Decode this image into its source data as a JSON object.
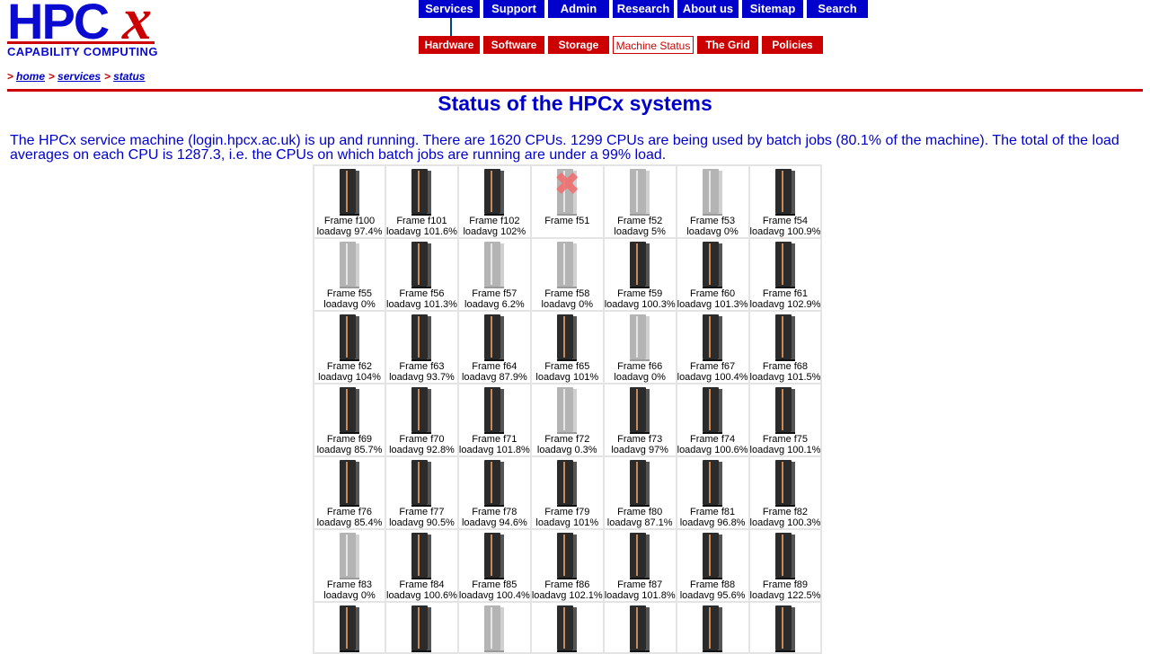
{
  "logo": {
    "main": "HPC",
    "x": "x",
    "subtitle": "CAPABILITY COMPUTING"
  },
  "nav_primary": [
    "Services",
    "Support",
    "Admin",
    "Research",
    "About us",
    "Sitemap",
    "Search"
  ],
  "nav_secondary": [
    "Hardware",
    "Software",
    "Storage",
    "Machine Status",
    "The Grid",
    "Policies"
  ],
  "breadcrumb": {
    "separator": ">",
    "items": [
      "home",
      "services",
      "status"
    ]
  },
  "title": "Status of the HPCx systems",
  "summary": "The HPCx service machine (login.hpcx.ac.uk) is up and running. There are 1620 CPUs. 1299 CPUs are being used by batch jobs (80.1% of the machine). The total of the load averages on each CPU is 1287.3, i.e. the CPUs on which batch jobs are running are under a 99% load.",
  "colors": {
    "nav_primary": "#0000cc",
    "nav_secondary": "#cc0000",
    "text": "#0000cc",
    "rule": "#cc0000"
  },
  "frames": [
    {
      "name": "Frame f100",
      "load": "loadavg 97.4%",
      "state": "busy"
    },
    {
      "name": "Frame f101",
      "load": "loadavg 101.6%",
      "state": "busy"
    },
    {
      "name": "Frame f102",
      "load": "loadavg 102%",
      "state": "busy"
    },
    {
      "name": "Frame f51",
      "load": "",
      "state": "down"
    },
    {
      "name": "Frame f52",
      "load": "loadavg 5%",
      "state": "idle"
    },
    {
      "name": "Frame f53",
      "load": "loadavg 0%",
      "state": "idle"
    },
    {
      "name": "Frame f54",
      "load": "loadavg 100.9%",
      "state": "busy"
    },
    {
      "name": "Frame f55",
      "load": "loadavg 0%",
      "state": "idle"
    },
    {
      "name": "Frame f56",
      "load": "loadavg 101.3%",
      "state": "busy"
    },
    {
      "name": "Frame f57",
      "load": "loadavg 6.2%",
      "state": "idle"
    },
    {
      "name": "Frame f58",
      "load": "loadavg 0%",
      "state": "idle"
    },
    {
      "name": "Frame f59",
      "load": "loadavg 100.3%",
      "state": "busy"
    },
    {
      "name": "Frame f60",
      "load": "loadavg 101.3%",
      "state": "busy"
    },
    {
      "name": "Frame f61",
      "load": "loadavg 102.9%",
      "state": "busy"
    },
    {
      "name": "Frame f62",
      "load": "loadavg 104%",
      "state": "busy"
    },
    {
      "name": "Frame f63",
      "load": "loadavg 93.7%",
      "state": "busy"
    },
    {
      "name": "Frame f64",
      "load": "loadavg 87.9%",
      "state": "busy"
    },
    {
      "name": "Frame f65",
      "load": "loadavg 101%",
      "state": "busy"
    },
    {
      "name": "Frame f66",
      "load": "loadavg 0%",
      "state": "idle"
    },
    {
      "name": "Frame f67",
      "load": "loadavg 100.4%",
      "state": "busy"
    },
    {
      "name": "Frame f68",
      "load": "loadavg 101.5%",
      "state": "busy"
    },
    {
      "name": "Frame f69",
      "load": "loadavg 85.7%",
      "state": "busy"
    },
    {
      "name": "Frame f70",
      "load": "loadavg 92.8%",
      "state": "busy"
    },
    {
      "name": "Frame f71",
      "load": "loadavg 101.8%",
      "state": "busy"
    },
    {
      "name": "Frame f72",
      "load": "loadavg 0.3%",
      "state": "idle"
    },
    {
      "name": "Frame f73",
      "load": "loadavg 97%",
      "state": "busy"
    },
    {
      "name": "Frame f74",
      "load": "loadavg 100.6%",
      "state": "busy"
    },
    {
      "name": "Frame f75",
      "load": "loadavg 100.1%",
      "state": "busy"
    },
    {
      "name": "Frame f76",
      "load": "loadavg 85.4%",
      "state": "busy"
    },
    {
      "name": "Frame f77",
      "load": "loadavg 90.5%",
      "state": "busy"
    },
    {
      "name": "Frame f78",
      "load": "loadavg 94.6%",
      "state": "busy"
    },
    {
      "name": "Frame f79",
      "load": "loadavg 101%",
      "state": "busy"
    },
    {
      "name": "Frame f80",
      "load": "loadavg 87.1%",
      "state": "busy"
    },
    {
      "name": "Frame f81",
      "load": "loadavg 96.8%",
      "state": "busy"
    },
    {
      "name": "Frame f82",
      "load": "loadavg 100.3%",
      "state": "busy"
    },
    {
      "name": "Frame f83",
      "load": "loadavg 0%",
      "state": "idle"
    },
    {
      "name": "Frame f84",
      "load": "loadavg 100.6%",
      "state": "busy"
    },
    {
      "name": "Frame f85",
      "load": "loadavg 100.4%",
      "state": "busy"
    },
    {
      "name": "Frame f86",
      "load": "loadavg 102.1%",
      "state": "busy"
    },
    {
      "name": "Frame f87",
      "load": "loadavg 101.8%",
      "state": "busy"
    },
    {
      "name": "Frame f88",
      "load": "loadavg 95.6%",
      "state": "busy"
    },
    {
      "name": "Frame f89",
      "load": "loadavg 122.5%",
      "state": "busy"
    }
  ],
  "partial_row_states": [
    "busy",
    "busy",
    "idle",
    "busy",
    "busy",
    "busy",
    "busy"
  ]
}
